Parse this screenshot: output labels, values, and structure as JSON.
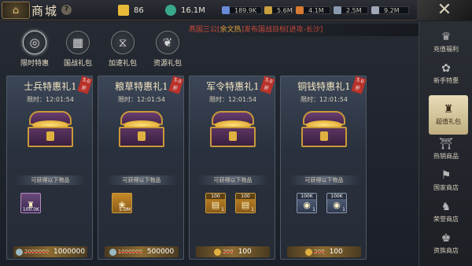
{
  "header": {
    "title": "商城",
    "help": "?",
    "resources": [
      {
        "name": "gold",
        "value": "86",
        "color": "#e8b838"
      },
      {
        "name": "silver",
        "value": "16.1M",
        "color": "#3aa88a"
      },
      {
        "name": "soldiers",
        "value": "189.9K",
        "color": "#6a8ad8"
      },
      {
        "name": "grain",
        "value": "5.6M",
        "color": "#c9a040"
      },
      {
        "name": "orders",
        "value": "4.1M",
        "color": "#d87a30"
      },
      {
        "name": "copper",
        "value": "2.5M",
        "color": "#8a9ab0"
      },
      {
        "name": "iron",
        "value": "9.2M",
        "color": "#a0a8b8"
      }
    ],
    "close": "✕"
  },
  "ticker": {
    "prefix": "燕国三公[",
    "name": "余文热",
    "suffix": "]发布国战目标[进攻-长沙]"
  },
  "tabs": [
    {
      "label": "限时特惠",
      "icon": "◎",
      "active": true
    },
    {
      "label": "国战礼包",
      "icon": "▦",
      "active": false
    },
    {
      "label": "加速礼包",
      "icon": "⧖",
      "active": false
    },
    {
      "label": "资源礼包",
      "icon": "❦",
      "active": false
    }
  ],
  "cards": [
    {
      "title": "士兵特惠礼1",
      "ribbon": "5.0折",
      "timer": "限时：12:01:54",
      "receive": "可获得以下物品",
      "items": [
        {
          "qty": "",
          "glyph": "♜",
          "count": "100.0K",
          "style": "purple"
        }
      ],
      "old_price": "2000000",
      "price": "1000000",
      "coin": "silver"
    },
    {
      "title": "粮草特惠礼1",
      "ribbon": "5.0折",
      "timer": "限时：12:01:54",
      "receive": "可获得以下物品",
      "items": [
        {
          "qty": "",
          "glyph": "❀",
          "count": "5.0M",
          "style": "gold"
        }
      ],
      "old_price": "1000000",
      "price": "500000",
      "coin": "silver"
    },
    {
      "title": "军令特惠礼1",
      "ribbon": "5.0折",
      "timer": "限时：12:01:54",
      "receive": "可获得以下物品",
      "items": [
        {
          "qty": "100",
          "glyph": "▤",
          "count": "1",
          "style": "gold"
        },
        {
          "qty": "100",
          "glyph": "▤",
          "count": "1",
          "style": "gold"
        }
      ],
      "old_price": "200",
      "price": "100",
      "coin": "gold"
    },
    {
      "title": "铜钱特惠礼1",
      "ribbon": "5.0折",
      "timer": "限时：12:01:54",
      "receive": "可获得以下物品",
      "items": [
        {
          "qty": "100K",
          "glyph": "◉",
          "count": "1",
          "style": "blue"
        },
        {
          "qty": "100K",
          "glyph": "◉",
          "count": "1",
          "style": "blue"
        }
      ],
      "old_price": "200",
      "price": "100",
      "coin": "gold"
    }
  ],
  "sidebar": [
    {
      "label": "充值福利",
      "icon": "♛",
      "active": false
    },
    {
      "label": "新手特惠",
      "icon": "✿",
      "active": false
    },
    {
      "label": "超值礼包",
      "icon": "♜",
      "active": true
    },
    {
      "label": "热销商品",
      "icon": "⛩",
      "active": false
    },
    {
      "label": "国家商店",
      "icon": "⚑",
      "active": false
    },
    {
      "label": "荣誉商店",
      "icon": "♞",
      "active": false
    },
    {
      "label": "资族商店",
      "icon": "♚",
      "active": false
    }
  ]
}
